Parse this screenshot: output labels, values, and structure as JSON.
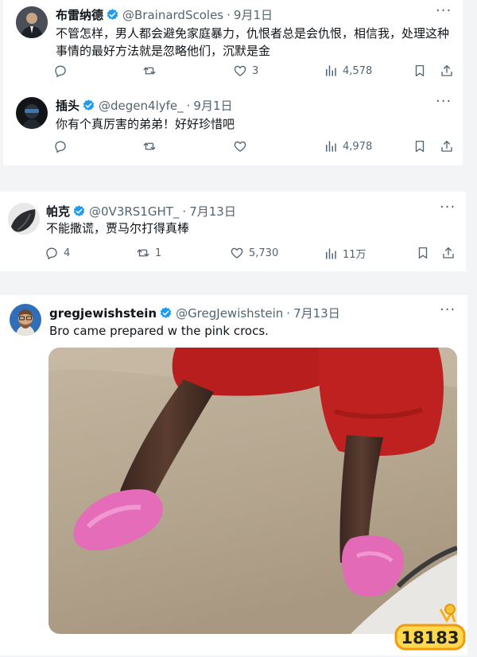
{
  "tweets": [
    {
      "name": "布雷纳德",
      "handle": "@BrainardScoles",
      "date": "9月1日",
      "text": "不管怎样，男人都会避免家庭暴力，仇恨者总是会仇恨，相信我，处理这种事情的最好方法就是忽略他们，沉默是金",
      "likes": "3",
      "views": "4,578"
    },
    {
      "name": "插头",
      "handle": "@degen4lyfe_",
      "date": "9月1日",
      "text": "你有个真厉害的弟弟！好好珍惜吧",
      "views": "4,978"
    },
    {
      "name": "帕克",
      "handle": "@0V3RS1GHT_",
      "date": "7月13日",
      "text": "不能撒谎，贾马尔打得真棒",
      "replies": "4",
      "retweets": "1",
      "likes": "5,730",
      "views": "11万"
    },
    {
      "name": "gregjewishstein",
      "handle": "@GregJewishstein",
      "date": "7月13日",
      "text": "Bro came prepared w the pink crocs."
    }
  ],
  "ui": {
    "dot": "·",
    "more": "···",
    "watermark": "18183"
  },
  "colors": {
    "verified": "#1d9bf0",
    "secondary_text": "#536471",
    "background": "#f3f4f6"
  },
  "icons": [
    "reply-icon",
    "retweet-icon",
    "like-icon",
    "views-icon",
    "bookmark-icon",
    "share-icon",
    "verified-badge-icon",
    "more-icon"
  ]
}
